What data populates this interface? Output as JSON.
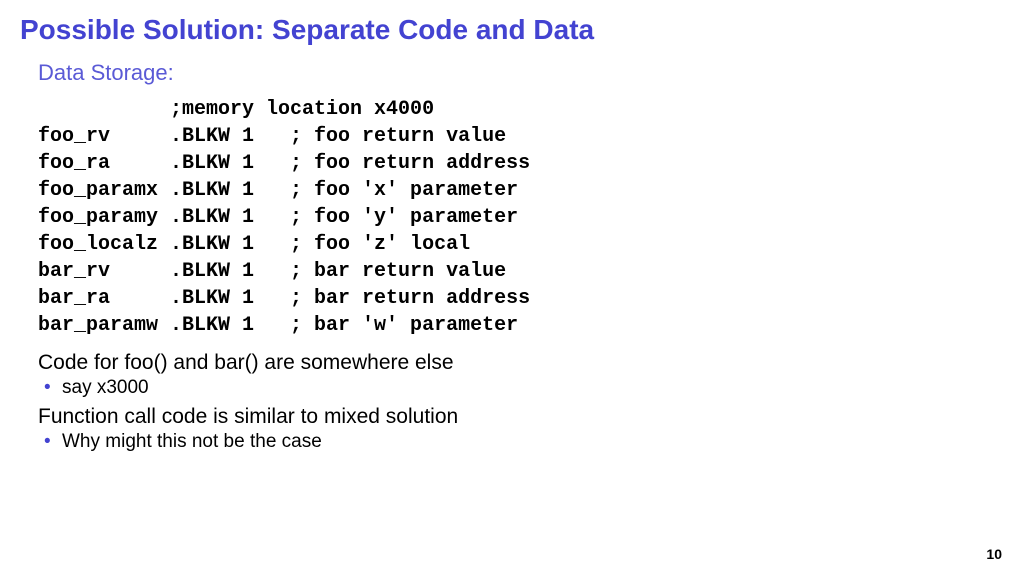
{
  "title": "Possible Solution: Separate Code and Data",
  "subtitle": "Data Storage:",
  "code": "           ;memory location x4000\nfoo_rv     .BLKW 1   ; foo return value\nfoo_ra     .BLKW 1   ; foo return address\nfoo_paramx .BLKW 1   ; foo 'x' parameter\nfoo_paramy .BLKW 1   ; foo 'y' parameter\nfoo_localz .BLKW 1   ; foo 'z' local\nbar_rv     .BLKW 1   ; bar return value\nbar_ra     .BLKW 1   ; bar return address\nbar_paramw .BLKW 1   ; bar 'w' parameter",
  "body1": "Code for foo() and bar() are somewhere else",
  "bullets1": [
    "say x3000"
  ],
  "body2": "Function call code is similar to mixed solution",
  "bullets2": [
    "Why might this not be the case"
  ],
  "pagenum": "10"
}
